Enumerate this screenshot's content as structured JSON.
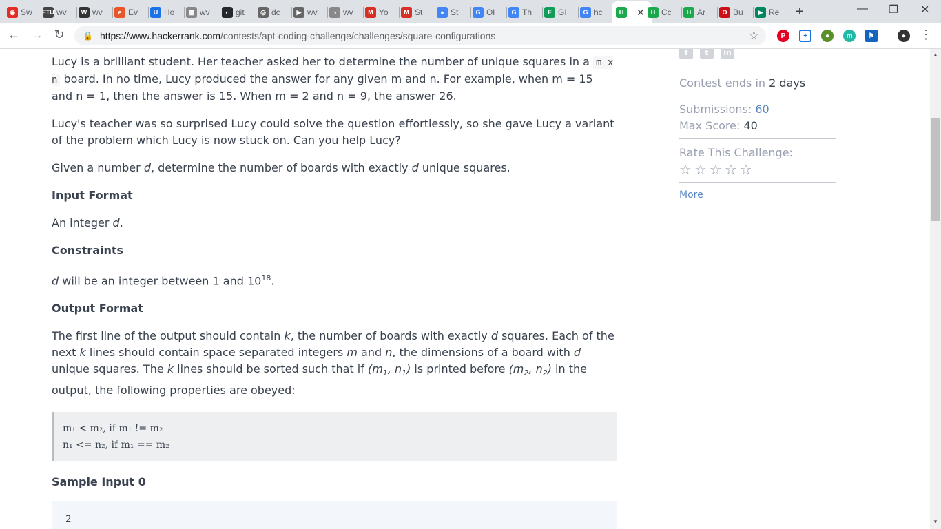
{
  "browser": {
    "tabs": [
      {
        "label": "Sw",
        "color": "#e52d27",
        "glyph": "◉"
      },
      {
        "label": "wv",
        "color": "#444",
        "glyph": "FTU"
      },
      {
        "label": "wv",
        "color": "#333",
        "glyph": "W"
      },
      {
        "label": "Ev",
        "color": "#e8572a",
        "glyph": "e"
      },
      {
        "label": "Ho",
        "color": "#1a73e8",
        "glyph": "U"
      },
      {
        "label": "wv",
        "color": "#888",
        "glyph": "▦"
      },
      {
        "label": "git",
        "color": "#24292e",
        "glyph": "◐"
      },
      {
        "label": "dc",
        "color": "#666",
        "glyph": "◎"
      },
      {
        "label": "wv",
        "color": "#666",
        "glyph": "▶"
      },
      {
        "label": "wv",
        "color": "#888",
        "glyph": "◑"
      },
      {
        "label": "Yo",
        "color": "#d93025",
        "glyph": "M"
      },
      {
        "label": "St",
        "color": "#d93025",
        "glyph": "M"
      },
      {
        "label": "St",
        "color": "#4285f4",
        "glyph": "●"
      },
      {
        "label": "Ol",
        "color": "#4285f4",
        "glyph": "G"
      },
      {
        "label": "Th",
        "color": "#4285f4",
        "glyph": "G"
      },
      {
        "label": "GI",
        "color": "#0f9d58",
        "glyph": "F"
      },
      {
        "label": "hc",
        "color": "#4285f4",
        "glyph": "G"
      },
      {
        "label": "",
        "color": "#1ba94c",
        "glyph": "H"
      },
      {
        "label": "Cc",
        "color": "#1ba94c",
        "glyph": "H"
      },
      {
        "label": "Ar",
        "color": "#1ba94c",
        "glyph": "H"
      },
      {
        "label": "Bu",
        "color": "#cc0f16",
        "glyph": "O"
      },
      {
        "label": "Re",
        "color": "#01875f",
        "glyph": "▶"
      }
    ],
    "url_host": "https://www.hackerrank.com",
    "url_path": "/contests/apt-coding-challenge/challenges/square-configurations"
  },
  "problem": {
    "p1_a": "Lucy is a brilliant student. Her teacher asked her to determine the number of unique squares in a ",
    "p1_code": "m x n",
    "p1_b": " board. In no time, Lucy produced the answer for any given m and n. For example, when m = 15 and n = 1, then the answer is 15. When m = 2 and n = 9, the answer 26.",
    "p2": "Lucy's teacher was so surprised Lucy could solve the question effortlessly, so she gave Lucy a variant of the problem which Lucy is now stuck on. Can you help Lucy?",
    "p3_a": "Given a number ",
    "p3_d": "d",
    "p3_b": ", determine the number of boards with exactly ",
    "p3_c": " unique squares.",
    "input_heading": "Input Format",
    "input_a": "An integer ",
    "input_d": "d",
    "input_b": ".",
    "constraints_heading": "Constraints",
    "constraints_d": "d",
    "constraints_text": " will be an integer between 1 and 10",
    "constraints_exp": "18",
    "constraints_end": ".",
    "output_heading": "Output Format",
    "output_1": "The first line of the output should contain ",
    "output_k": "k",
    "output_2": ", the number of boards with exactly ",
    "output_d": "d",
    "output_3": " squares. Each of the next ",
    "output_4": " lines should contain space separated integers ",
    "output_m": "m",
    "output_and": " and ",
    "output_n": "n",
    "output_5": ", the dimensions of a board with ",
    "output_6": " unique squares. The ",
    "output_7": " lines should be sorted such that if ",
    "output_pair1": "(m",
    "output_pair1_sub": "1",
    "output_pair1_mid": ", n",
    "output_pair1_end": ")",
    "output_8": " is printed before ",
    "output_pair2": "(m",
    "output_pair2_sub": "2",
    "output_pair2_mid": ", n",
    "output_pair2_end": ")",
    "output_9": " in the output, the following properties are obeyed:",
    "code_line1": "m₁ < m₂, if m₁ != m₂",
    "code_line2": "n₁ <= n₂, if m₁ == m₂",
    "sample_heading": "Sample Input 0",
    "sample_input": "2"
  },
  "sidebar": {
    "contest_label": "Contest ends in ",
    "contest_value": "2 days",
    "submissions_label": "Submissions: ",
    "submissions_value": "60",
    "max_score_label": "Max Score: ",
    "max_score_value": "40",
    "rate_label": "Rate This Challenge:",
    "more_link": "More",
    "social": [
      "f",
      "t",
      "in"
    ]
  }
}
